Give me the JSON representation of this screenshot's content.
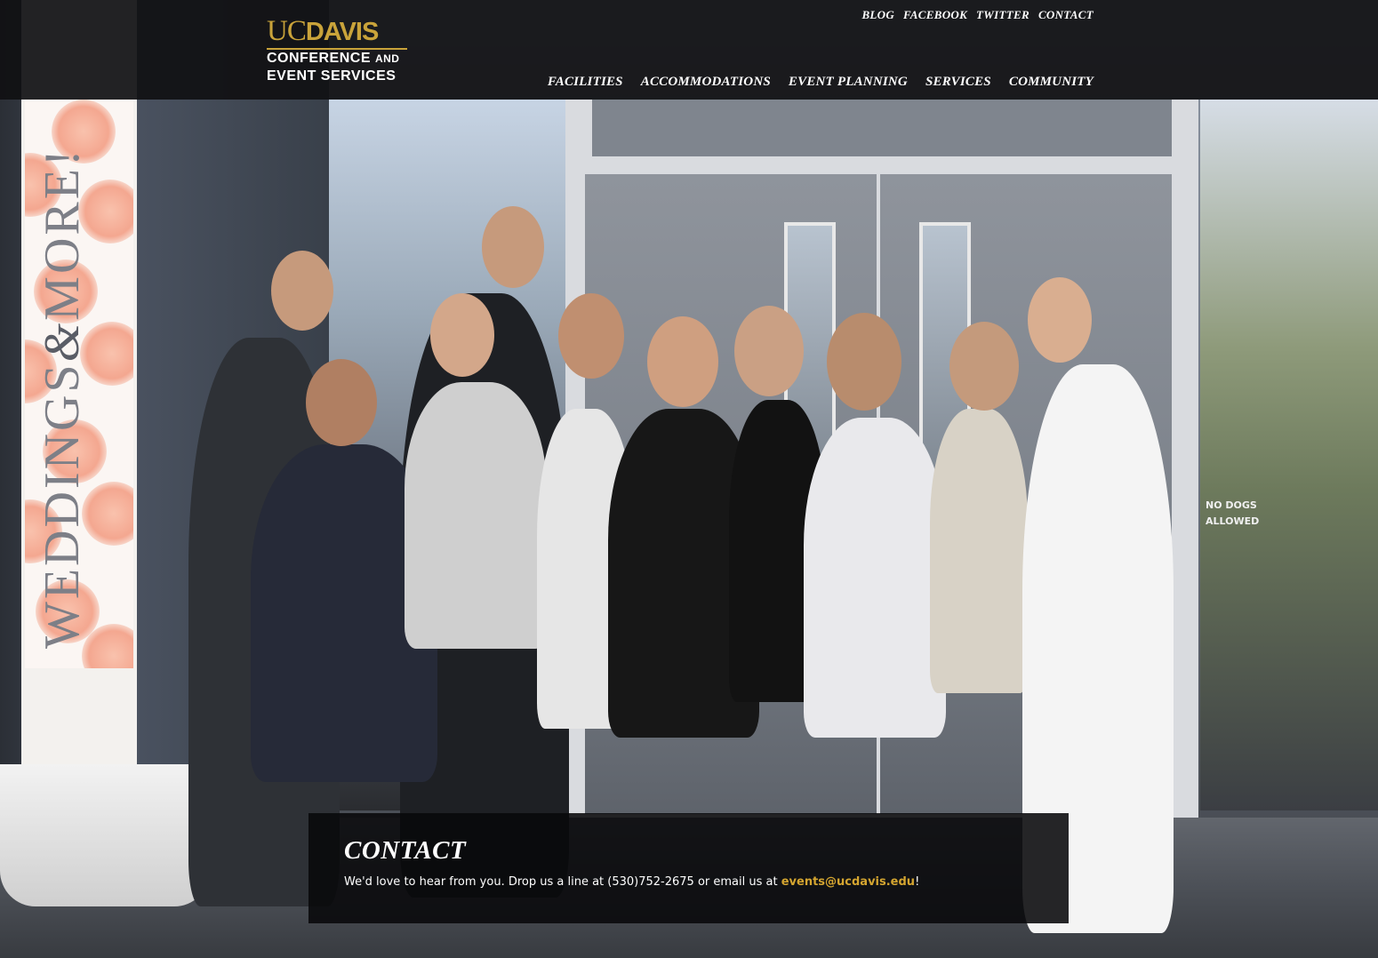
{
  "brand": {
    "uc": "UC",
    "davis": "DAVIS",
    "line1": "CONFERENCE",
    "line1_and": "AND",
    "line2": "EVENT SERVICES",
    "color": "#c9a33a"
  },
  "utility_nav": [
    {
      "label": "BLOG"
    },
    {
      "label": "FACEBOOK"
    },
    {
      "label": "TWITTER"
    },
    {
      "label": "CONTACT"
    }
  ],
  "main_nav": [
    {
      "label": "FACILITIES"
    },
    {
      "label": "ACCOMMODATIONS"
    },
    {
      "label": "EVENT PLANNING"
    },
    {
      "label": "SERVICES"
    },
    {
      "label": "COMMUNITY"
    }
  ],
  "photo": {
    "banner_word1": "WEDDINGS",
    "banner_amp": "&",
    "banner_word2": "MORE!",
    "sign_line1": "NO DOGS",
    "sign_line2": "ALLOWED"
  },
  "contact": {
    "title": "CONTACT",
    "text_before": "We'd love to hear from you. Drop us a line at (530)752-2675 or email us at ",
    "email": "events@ucdavis.edu",
    "text_after": "!",
    "email_color": "#d4a530"
  }
}
